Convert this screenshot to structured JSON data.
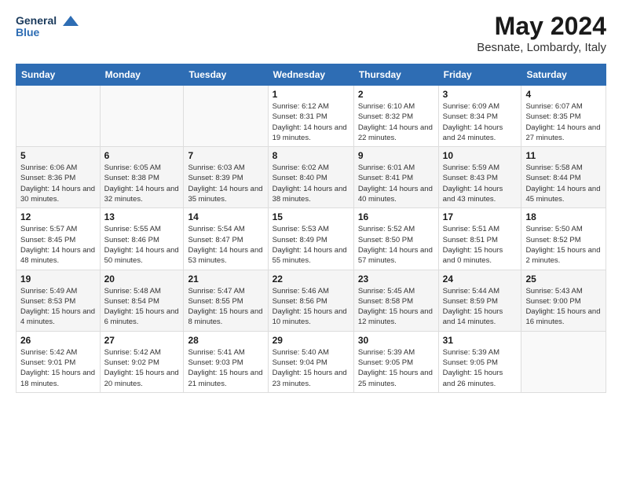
{
  "header": {
    "logo_line1": "General",
    "logo_line2": "Blue",
    "month_year": "May 2024",
    "location": "Besnate, Lombardy, Italy"
  },
  "days_of_week": [
    "Sunday",
    "Monday",
    "Tuesday",
    "Wednesday",
    "Thursday",
    "Friday",
    "Saturday"
  ],
  "weeks": [
    [
      {
        "day": "",
        "info": ""
      },
      {
        "day": "",
        "info": ""
      },
      {
        "day": "",
        "info": ""
      },
      {
        "day": "1",
        "info": "Sunrise: 6:12 AM\nSunset: 8:31 PM\nDaylight: 14 hours\nand 19 minutes."
      },
      {
        "day": "2",
        "info": "Sunrise: 6:10 AM\nSunset: 8:32 PM\nDaylight: 14 hours\nand 22 minutes."
      },
      {
        "day": "3",
        "info": "Sunrise: 6:09 AM\nSunset: 8:34 PM\nDaylight: 14 hours\nand 24 minutes."
      },
      {
        "day": "4",
        "info": "Sunrise: 6:07 AM\nSunset: 8:35 PM\nDaylight: 14 hours\nand 27 minutes."
      }
    ],
    [
      {
        "day": "5",
        "info": "Sunrise: 6:06 AM\nSunset: 8:36 PM\nDaylight: 14 hours\nand 30 minutes."
      },
      {
        "day": "6",
        "info": "Sunrise: 6:05 AM\nSunset: 8:38 PM\nDaylight: 14 hours\nand 32 minutes."
      },
      {
        "day": "7",
        "info": "Sunrise: 6:03 AM\nSunset: 8:39 PM\nDaylight: 14 hours\nand 35 minutes."
      },
      {
        "day": "8",
        "info": "Sunrise: 6:02 AM\nSunset: 8:40 PM\nDaylight: 14 hours\nand 38 minutes."
      },
      {
        "day": "9",
        "info": "Sunrise: 6:01 AM\nSunset: 8:41 PM\nDaylight: 14 hours\nand 40 minutes."
      },
      {
        "day": "10",
        "info": "Sunrise: 5:59 AM\nSunset: 8:43 PM\nDaylight: 14 hours\nand 43 minutes."
      },
      {
        "day": "11",
        "info": "Sunrise: 5:58 AM\nSunset: 8:44 PM\nDaylight: 14 hours\nand 45 minutes."
      }
    ],
    [
      {
        "day": "12",
        "info": "Sunrise: 5:57 AM\nSunset: 8:45 PM\nDaylight: 14 hours\nand 48 minutes."
      },
      {
        "day": "13",
        "info": "Sunrise: 5:55 AM\nSunset: 8:46 PM\nDaylight: 14 hours\nand 50 minutes."
      },
      {
        "day": "14",
        "info": "Sunrise: 5:54 AM\nSunset: 8:47 PM\nDaylight: 14 hours\nand 53 minutes."
      },
      {
        "day": "15",
        "info": "Sunrise: 5:53 AM\nSunset: 8:49 PM\nDaylight: 14 hours\nand 55 minutes."
      },
      {
        "day": "16",
        "info": "Sunrise: 5:52 AM\nSunset: 8:50 PM\nDaylight: 14 hours\nand 57 minutes."
      },
      {
        "day": "17",
        "info": "Sunrise: 5:51 AM\nSunset: 8:51 PM\nDaylight: 15 hours\nand 0 minutes."
      },
      {
        "day": "18",
        "info": "Sunrise: 5:50 AM\nSunset: 8:52 PM\nDaylight: 15 hours\nand 2 minutes."
      }
    ],
    [
      {
        "day": "19",
        "info": "Sunrise: 5:49 AM\nSunset: 8:53 PM\nDaylight: 15 hours\nand 4 minutes."
      },
      {
        "day": "20",
        "info": "Sunrise: 5:48 AM\nSunset: 8:54 PM\nDaylight: 15 hours\nand 6 minutes."
      },
      {
        "day": "21",
        "info": "Sunrise: 5:47 AM\nSunset: 8:55 PM\nDaylight: 15 hours\nand 8 minutes."
      },
      {
        "day": "22",
        "info": "Sunrise: 5:46 AM\nSunset: 8:56 PM\nDaylight: 15 hours\nand 10 minutes."
      },
      {
        "day": "23",
        "info": "Sunrise: 5:45 AM\nSunset: 8:58 PM\nDaylight: 15 hours\nand 12 minutes."
      },
      {
        "day": "24",
        "info": "Sunrise: 5:44 AM\nSunset: 8:59 PM\nDaylight: 15 hours\nand 14 minutes."
      },
      {
        "day": "25",
        "info": "Sunrise: 5:43 AM\nSunset: 9:00 PM\nDaylight: 15 hours\nand 16 minutes."
      }
    ],
    [
      {
        "day": "26",
        "info": "Sunrise: 5:42 AM\nSunset: 9:01 PM\nDaylight: 15 hours\nand 18 minutes."
      },
      {
        "day": "27",
        "info": "Sunrise: 5:42 AM\nSunset: 9:02 PM\nDaylight: 15 hours\nand 20 minutes."
      },
      {
        "day": "28",
        "info": "Sunrise: 5:41 AM\nSunset: 9:03 PM\nDaylight: 15 hours\nand 21 minutes."
      },
      {
        "day": "29",
        "info": "Sunrise: 5:40 AM\nSunset: 9:04 PM\nDaylight: 15 hours\nand 23 minutes."
      },
      {
        "day": "30",
        "info": "Sunrise: 5:39 AM\nSunset: 9:05 PM\nDaylight: 15 hours\nand 25 minutes."
      },
      {
        "day": "31",
        "info": "Sunrise: 5:39 AM\nSunset: 9:05 PM\nDaylight: 15 hours\nand 26 minutes."
      },
      {
        "day": "",
        "info": ""
      }
    ]
  ]
}
